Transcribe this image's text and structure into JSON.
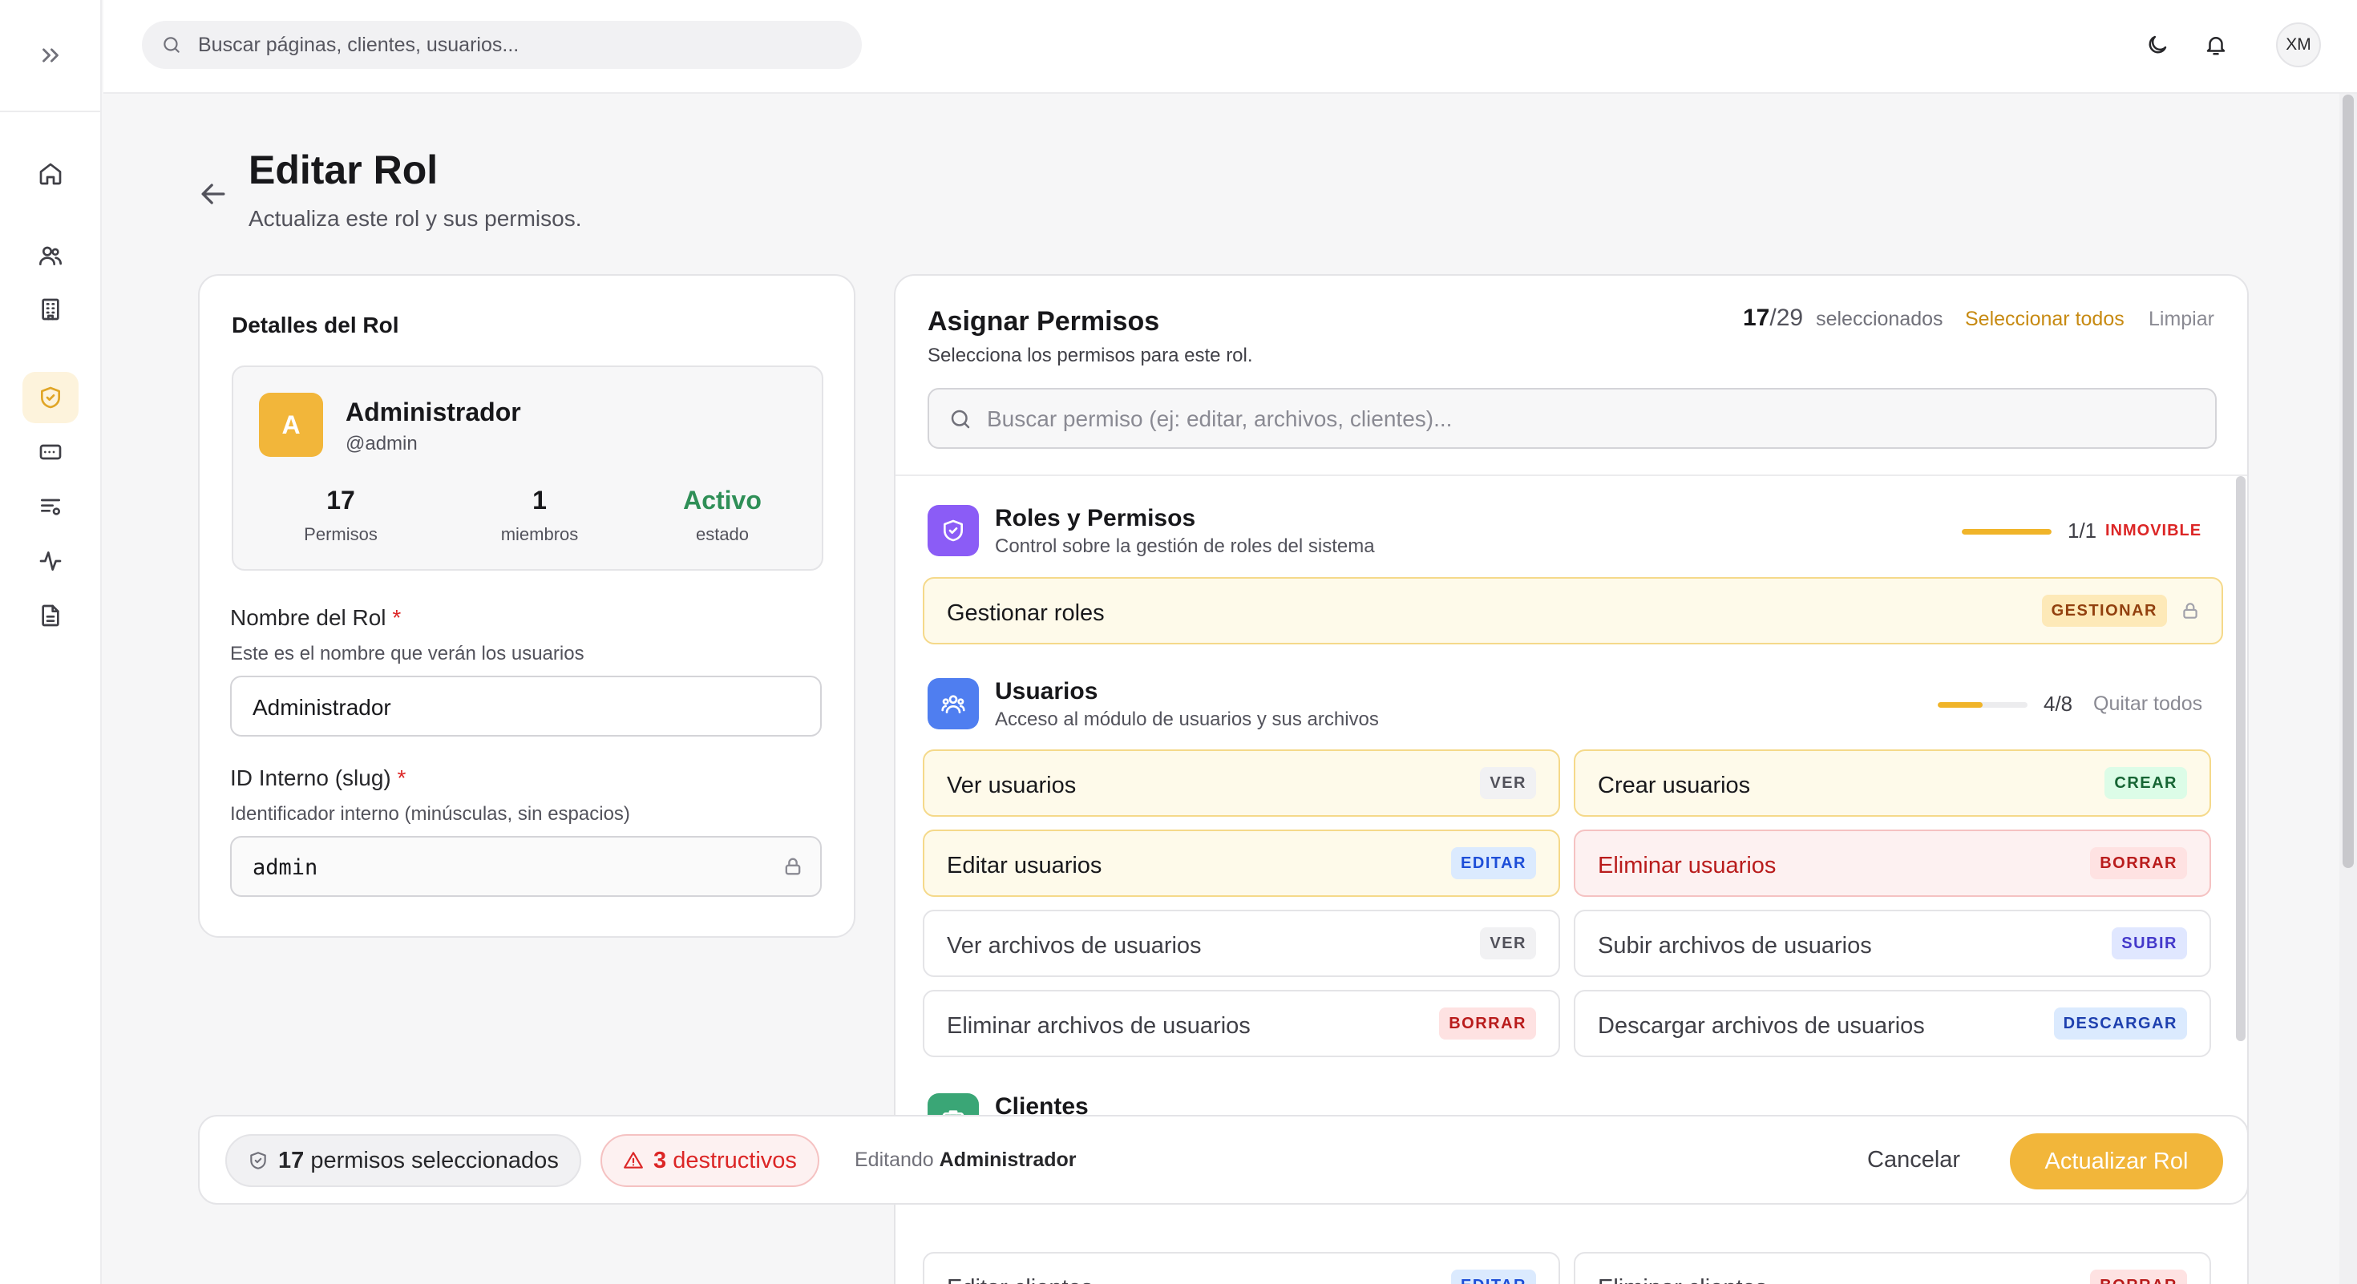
{
  "topbar": {
    "search_placeholder": "Buscar páginas, clientes, usuarios...",
    "avatar_initials": "XM"
  },
  "page": {
    "title": "Editar Rol",
    "subtitle": "Actualiza este rol y sus permisos."
  },
  "details": {
    "heading": "Detalles del Rol",
    "role_initial": "A",
    "role_name": "Administrador",
    "role_handle": "@admin",
    "stats": [
      {
        "value": "17",
        "label": "Permisos"
      },
      {
        "value": "1",
        "label": "miembros"
      },
      {
        "value": "Activo",
        "label": "estado"
      }
    ],
    "name_label": "Nombre del Rol",
    "name_help": "Este es el nombre que verán los usuarios",
    "name_value": "Administrador",
    "slug_label": "ID Interno (slug)",
    "slug_help": "Identificador interno (minúsculas, sin espacios)",
    "slug_value": "admin",
    "required_mark": "*"
  },
  "permissions": {
    "heading": "Asignar Permisos",
    "subheading": "Selecciona los permisos para este rol.",
    "selected_count": "17",
    "total_count": "/29",
    "selected_label": "seleccionados",
    "select_all": "Seleccionar todos",
    "clear": "Limpiar",
    "search_placeholder": "Buscar permiso (ej: editar, archivos, clientes)...",
    "groups": [
      {
        "title": "Roles y Permisos",
        "subtitle": "Control sobre la gestión de roles del sistema",
        "count": "1/1",
        "progress": 1.0,
        "action": "INMOVIBLE",
        "items": [
          {
            "label": "Gestionar roles",
            "badge": "GESTIONAR"
          }
        ]
      },
      {
        "title": "Usuarios",
        "subtitle": "Acceso al módulo de usuarios y sus archivos",
        "count": "4/8",
        "progress": 0.5,
        "action": "Quitar todos",
        "items": [
          {
            "label": "Ver usuarios",
            "badge": "VER"
          },
          {
            "label": "Crear usuarios",
            "badge": "CREAR"
          },
          {
            "label": "Editar usuarios",
            "badge": "EDITAR"
          },
          {
            "label": "Eliminar usuarios",
            "badge": "BORRAR"
          },
          {
            "label": "Ver archivos de usuarios",
            "badge": "VER"
          },
          {
            "label": "Subir archivos de usuarios",
            "badge": "SUBIR"
          },
          {
            "label": "Eliminar archivos de usuarios",
            "badge": "BORRAR"
          },
          {
            "label": "Descargar archivos de usuarios",
            "badge": "DESCARGAR"
          }
        ]
      },
      {
        "title": "Clientes",
        "items": [
          {
            "label": "Editar clientes",
            "badge": "EDITAR"
          },
          {
            "label": "Eliminar clientes",
            "badge": "BORRAR"
          }
        ]
      }
    ]
  },
  "footer": {
    "selected_count": "17",
    "selected_text": "permisos seleccionados",
    "destructive_count": "3",
    "destructive_text": "destructivos",
    "editing_label": "Editando",
    "editing_name": "Administrador",
    "cancel": "Cancelar",
    "submit": "Actualizar Rol"
  },
  "colors": {
    "accent": "#f0b429",
    "active_green": "#2f8f57",
    "danger": "#dc2626",
    "roles_icon": "#8b5cf6",
    "users_icon": "#4f7ef0",
    "clients_icon": "#3aa676"
  }
}
